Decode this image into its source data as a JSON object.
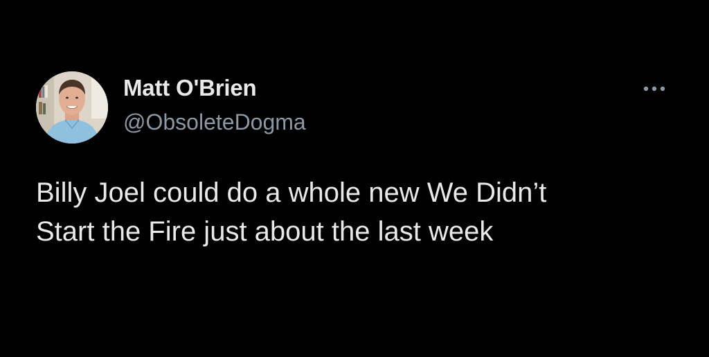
{
  "author": {
    "display_name": "Matt O'Brien",
    "handle": "@ObsoleteDogma",
    "avatar_icon": "profile-photo"
  },
  "tweet": {
    "text": "Billy Joel could do a whole new We Didn’t\nStart the Fire just about the last week"
  },
  "actions": {
    "more_icon": "more-horizontal-icon"
  },
  "colors": {
    "background": "#000000",
    "primary_text": "#e7e9ea",
    "secondary_text": "#8b98a5"
  }
}
